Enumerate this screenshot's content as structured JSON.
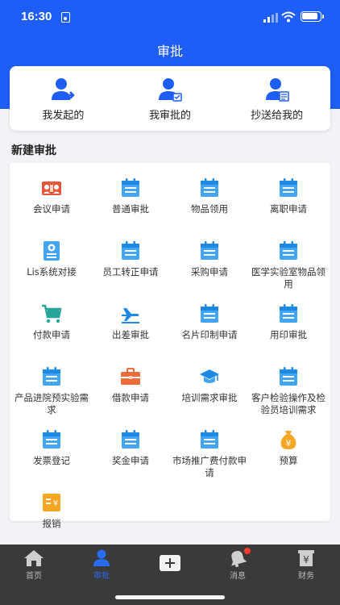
{
  "status": {
    "time": "16:30"
  },
  "header": {
    "title": "审批"
  },
  "top_actions": [
    {
      "label": "我发起的"
    },
    {
      "label": "我审批的"
    },
    {
      "label": "抄送给我的"
    }
  ],
  "section": {
    "title": "新建审批"
  },
  "items": [
    {
      "label": "会议申请",
      "icon": "meeting-icon"
    },
    {
      "label": "普通审批",
      "icon": "calendar-icon"
    },
    {
      "label": "物品领用",
      "icon": "calendar-icon"
    },
    {
      "label": "离职申请",
      "icon": "calendar-icon"
    },
    {
      "label": "Lis系统对接",
      "icon": "document-icon"
    },
    {
      "label": "员工转正申请",
      "icon": "calendar-icon"
    },
    {
      "label": "采购申请",
      "icon": "calendar-icon"
    },
    {
      "label": "医学实验室物品领用",
      "icon": "calendar-icon"
    },
    {
      "label": "付款申请",
      "icon": "cart-icon"
    },
    {
      "label": "出差审批",
      "icon": "plane-icon"
    },
    {
      "label": "名片印制申请",
      "icon": "calendar-icon"
    },
    {
      "label": "用印审批",
      "icon": "calendar-icon"
    },
    {
      "label": "产品进院预实验需求",
      "icon": "calendar-icon"
    },
    {
      "label": "借款申请",
      "icon": "toolbox-icon"
    },
    {
      "label": "培训需求审批",
      "icon": "graduation-cap-icon"
    },
    {
      "label": "客户检验操作及检验员培训需求",
      "icon": "calendar-icon"
    },
    {
      "label": "发票登记",
      "icon": "calendar-icon"
    },
    {
      "label": "奖金申请",
      "icon": "calendar-icon"
    },
    {
      "label": "市场推广费付款申请",
      "icon": "calendar-icon"
    },
    {
      "label": "预算",
      "icon": "money-bag-icon"
    },
    {
      "label": "报销",
      "icon": "receipt-icon"
    }
  ],
  "tabbar": [
    {
      "label": "首页",
      "icon": "home-icon"
    },
    {
      "label": "审批",
      "icon": "person-icon",
      "active": true
    },
    {
      "label": "",
      "icon": "plus-icon"
    },
    {
      "label": "消息",
      "icon": "bell-icon"
    },
    {
      "label": "财务",
      "icon": "finance-icon"
    }
  ],
  "colors": {
    "primary": "#1e5ef6",
    "accent_orange": "#f57c3a",
    "icon_blue": "#42a5f5",
    "tabbar_bg": "#3a3a3a"
  }
}
